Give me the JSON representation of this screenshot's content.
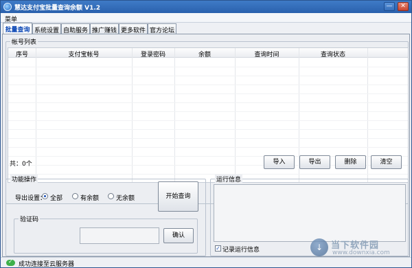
{
  "window": {
    "title": "慧达支付宝批量查询余额 V1.2",
    "minimize": "—",
    "close": "✕"
  },
  "menu": {
    "label": "菜单"
  },
  "tabs": [
    "批量查询",
    "系统设置",
    "自助服务",
    "推广赚钱",
    "更多软件",
    "官方论坛"
  ],
  "accounts": {
    "title": "帐号列表",
    "columns": [
      "序号",
      "支付宝帐号",
      "登录密码",
      "余额",
      "查询时间",
      "查询状态"
    ],
    "rows": [],
    "count_label": "共：0个"
  },
  "actions": {
    "import": "导入",
    "export": "导出",
    "delete": "删除",
    "clear": "清空"
  },
  "functions": {
    "title": "功能操作",
    "export_label": "导出设置：",
    "options": [
      {
        "label": "全部",
        "checked": true
      },
      {
        "label": "有余额",
        "checked": false
      },
      {
        "label": "无余额",
        "checked": false
      }
    ],
    "start_button": "开始查询",
    "captcha": {
      "title": "验证码",
      "value": "",
      "confirm": "确认"
    }
  },
  "run_info": {
    "title": "运行信息",
    "log": "",
    "record_label": "记录运行信息",
    "record_checked": true
  },
  "status": {
    "text": "成功连接至云服务器"
  },
  "watermark": {
    "title": "当下软件园",
    "sub": "www.downxia.com",
    "icon": "↓"
  },
  "colors": {
    "titlebar": "#2a61ad",
    "active_tab": "#0a46b4",
    "status_ok": "#3db04a"
  }
}
